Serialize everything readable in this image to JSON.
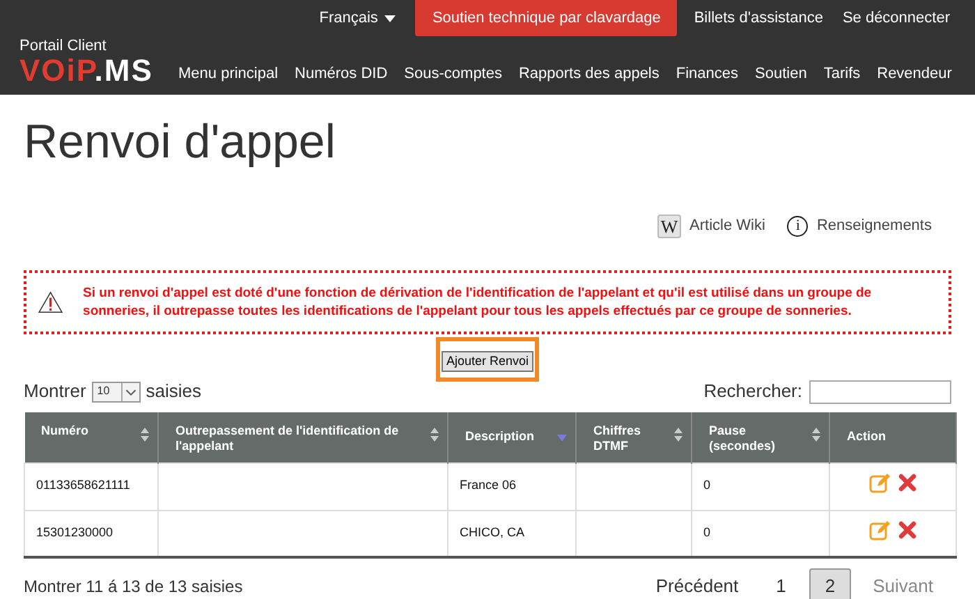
{
  "top_bar": {
    "language": "Français",
    "chat_button": "Soutien technique par clavardage",
    "links": [
      "Billets d'assistance",
      "Se déconnecter"
    ]
  },
  "brand": {
    "caption": "Portail Client",
    "logo_primary": "VOiP",
    "logo_secondary": ".MS"
  },
  "nav": [
    "Menu principal",
    "Numéros DID",
    "Sous-comptes",
    "Rapports des appels",
    "Finances",
    "Soutien",
    "Tarifs",
    "Revendeur"
  ],
  "page_title": "Renvoi d'appel",
  "help_links": [
    {
      "kind": "wiki",
      "icon_text": "W",
      "label": "Article Wiki"
    },
    {
      "kind": "info",
      "icon_text": "i",
      "label": "Renseignements"
    }
  ],
  "warning": "Si un renvoi d'appel est doté d'une fonction de dérivation de l'identification de l'appelant et qu'il est utilisé dans un groupe de sonneries, il outrepasse toutes les identifications de l'appelant pour tous les appels effectués par ce groupe de sonneries.",
  "add_button": "Ajouter Renvoi",
  "length_control": {
    "before": "Montrer",
    "value": "10",
    "after": "saisies"
  },
  "search": {
    "label": "Rechercher:"
  },
  "table": {
    "columns": [
      {
        "label": "Numéro",
        "sortable": true,
        "sorted": false
      },
      {
        "label": "Outrepassement de l'identification de l'appelant",
        "sortable": true,
        "sorted": false
      },
      {
        "label": "Description",
        "sortable": true,
        "sorted": true
      },
      {
        "label": "Chiffres DTMF",
        "sortable": true,
        "sorted": false
      },
      {
        "label": "Pause (secondes)",
        "sortable": true,
        "sorted": false
      },
      {
        "label": "Action",
        "sortable": false,
        "sorted": false
      }
    ],
    "rows": [
      {
        "cells": [
          "01133658621111",
          "",
          "France 06",
          "",
          "0"
        ]
      },
      {
        "cells": [
          "15301230000",
          "",
          "CHICO, CA",
          "",
          "0"
        ]
      }
    ]
  },
  "info": "Montrer 11 á 13 de 13 saisies",
  "pagination": [
    {
      "label": "Précédent",
      "kind": "prev",
      "selected": false,
      "disabled": false
    },
    {
      "label": "1",
      "kind": "page",
      "selected": false,
      "disabled": false
    },
    {
      "label": "2",
      "kind": "page",
      "selected": true,
      "disabled": false
    },
    {
      "label": "Suivant",
      "kind": "next",
      "selected": false,
      "disabled": true
    }
  ]
}
